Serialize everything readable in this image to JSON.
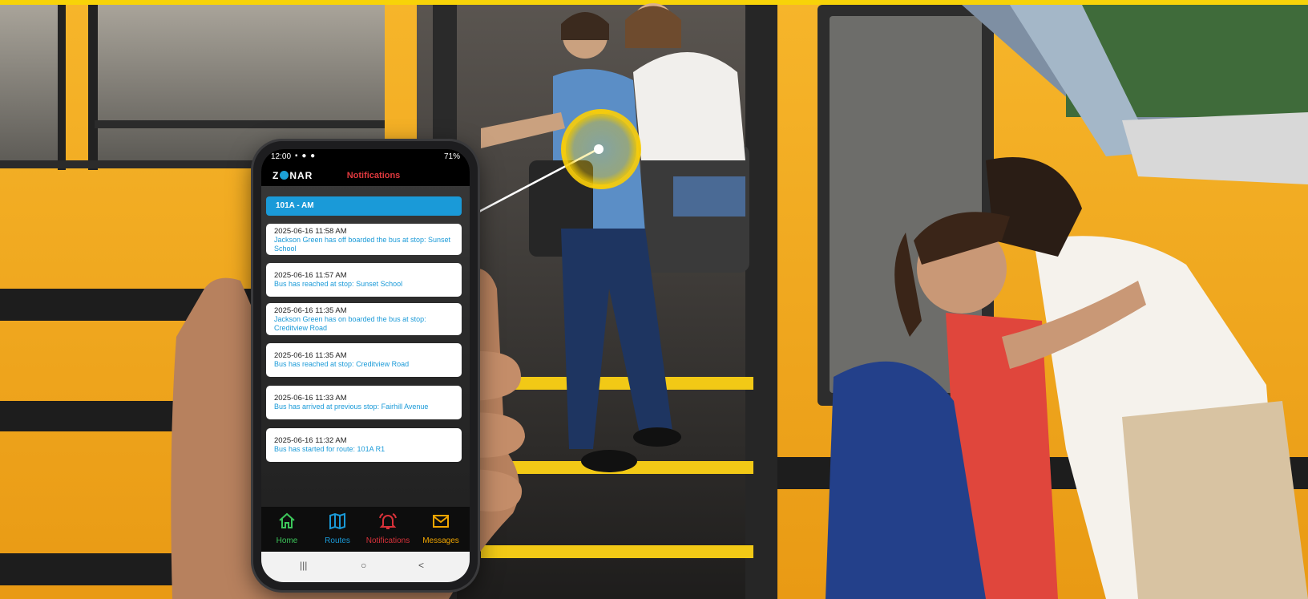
{
  "phone": {
    "status": {
      "time": "12:00",
      "battery": "71%"
    },
    "app": {
      "logo": "ZONAR",
      "title": "Notifications"
    },
    "route": "101A - AM",
    "notifications": [
      {
        "time": "2025-06-16 11:58 AM",
        "message": "Jackson Green has off boarded the bus at stop: Sunset School"
      },
      {
        "time": "2025-06-16 11:57 AM",
        "message": "Bus has reached at stop: Sunset School"
      },
      {
        "time": "2025-06-16 11:35 AM",
        "message": "Jackson Green has on boarded the bus at stop: Creditview Road"
      },
      {
        "time": "2025-06-16 11:35 AM",
        "message": "Bus has reached at stop: Creditview Road"
      },
      {
        "time": "2025-06-16 11:33 AM",
        "message": "Bus has arrived at previous stop: Fairhill Avenue"
      },
      {
        "time": "2025-06-16 11:32 AM",
        "message": "Bus has started for route: 101A R1"
      }
    ],
    "tabs": [
      {
        "label": "Home",
        "icon": "home-icon",
        "color": "#3cc65a"
      },
      {
        "label": "Routes",
        "icon": "map-icon",
        "color": "#1a9ad8"
      },
      {
        "label": "Notifications",
        "icon": "bell-icon",
        "color": "#d8323a"
      },
      {
        "label": "Messages",
        "icon": "envelope-icon",
        "color": "#f0a500"
      }
    ],
    "nav": {
      "recents": "|||",
      "home": "○",
      "back": "<"
    }
  },
  "colors": {
    "bus_yellow": "#f2a91d",
    "accent_blue": "#1a9ad8",
    "alert_red": "#e0393e",
    "highlight": "#f8cd0a"
  }
}
